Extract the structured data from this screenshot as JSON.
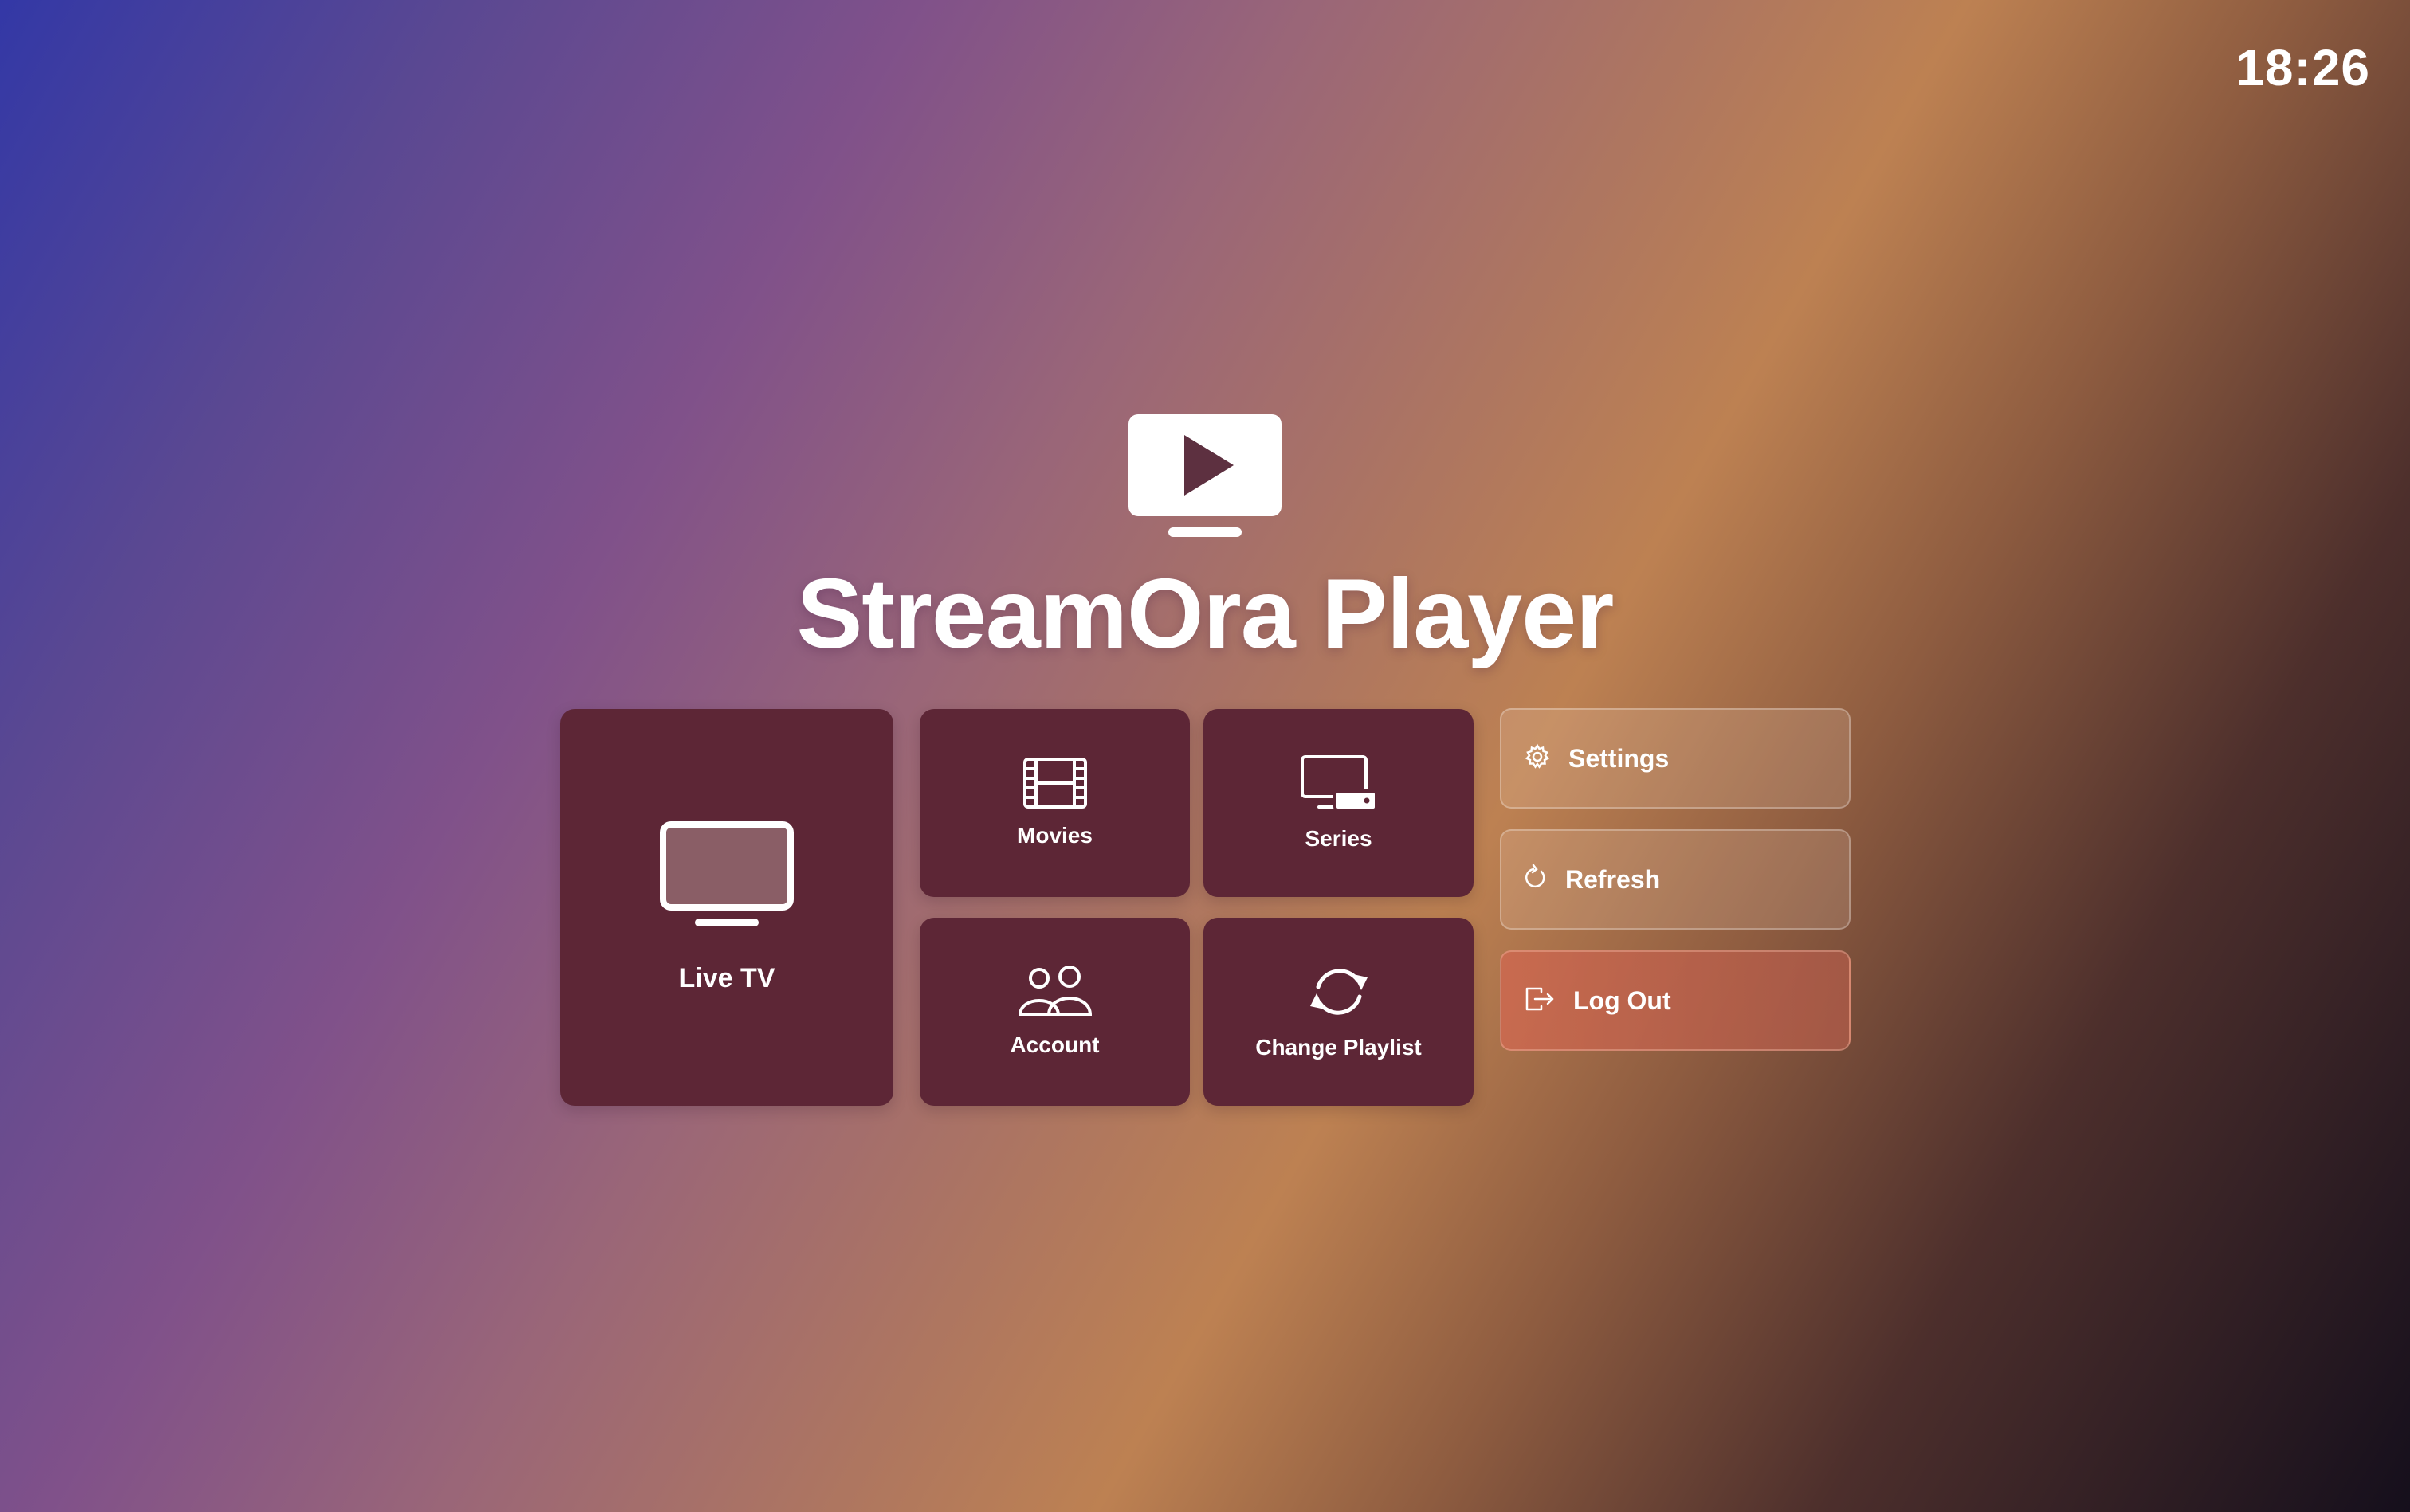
{
  "clock": {
    "time": "18:26"
  },
  "app": {
    "title": "StreamOra Player",
    "logo_icon": "tv-play-icon"
  },
  "tiles": [
    {
      "id": "live-tv",
      "label": "Live TV",
      "icon": "tv-icon"
    },
    {
      "id": "movies",
      "label": "Movies",
      "icon": "film-icon"
    },
    {
      "id": "series",
      "label": "Series",
      "icon": "monitor-device-icon"
    },
    {
      "id": "account",
      "label": "Account",
      "icon": "users-icon"
    },
    {
      "id": "change-playlist",
      "label": "Change Playlist",
      "icon": "sync-icon"
    }
  ],
  "side_buttons": [
    {
      "id": "settings",
      "label": "Settings",
      "icon": "gear-icon"
    },
    {
      "id": "refresh",
      "label": "Refresh",
      "icon": "refresh-icon"
    },
    {
      "id": "logout",
      "label": "Log Out",
      "icon": "logout-icon"
    }
  ],
  "colors": {
    "tile_background": "#5d2636",
    "logout_accent": "#cd6950",
    "text": "#ffffff"
  }
}
